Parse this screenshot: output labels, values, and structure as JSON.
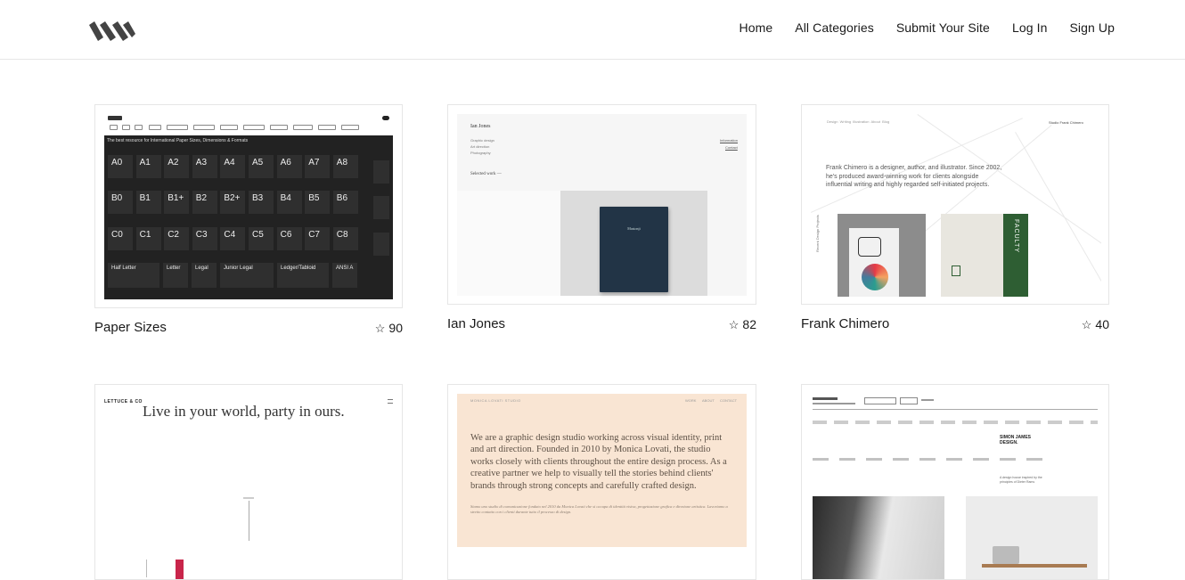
{
  "nav": {
    "home": "Home",
    "all_categories": "All Categories",
    "submit_site": "Submit Your Site",
    "log_in": "Log In",
    "sign_up": "Sign Up"
  },
  "cards": [
    {
      "title": "Paper Sizes",
      "stars": "90"
    },
    {
      "title": "Ian Jones",
      "stars": "82"
    },
    {
      "title": "Frank Chimero",
      "stars": "40"
    },
    {
      "title": "",
      "stars": ""
    },
    {
      "title": "",
      "stars": ""
    },
    {
      "title": "",
      "stars": ""
    }
  ],
  "paper_sizes": {
    "banner": "The best resource for International Paper Sizes, Dimensions & Formats",
    "row_a": [
      "A0",
      "A1",
      "A2",
      "A3",
      "A4",
      "A5",
      "A6",
      "A7",
      "A8"
    ],
    "row_b": [
      "B0",
      "B1",
      "B1+",
      "B2",
      "B2+",
      "B3",
      "B4",
      "B5",
      "B6"
    ],
    "row_c": [
      "C0",
      "C1",
      "C2",
      "C3",
      "C4",
      "C5",
      "C6",
      "C7",
      "C8"
    ],
    "row_us": [
      "Half Letter",
      "Letter",
      "Legal",
      "Junior Legal",
      "Ledger/Tabloid",
      "ANSI A"
    ]
  },
  "ian_jones": {
    "name": "Ian Jones",
    "roles": [
      "Graphic design",
      "Art direction",
      "Photography"
    ],
    "links": [
      "Information",
      "Contact"
    ],
    "selected": "Selected work —",
    "book": "Mustonji"
  },
  "frank": {
    "nav": "Design  Writing  Illustration  About  Blog",
    "studio": "Studio Frank Chimero",
    "bio": "Frank Chimero is a designer, author, and illustrator. Since 2002, he's produced award-winning work for clients alongside influential writing and highly regarded self-initiated projects.",
    "side": "Recent Design Projects",
    "faculty": "FACULTY"
  },
  "lettuce": {
    "brand": "LETTUCE & CO",
    "headline": "Live in your world, party in ours."
  },
  "studio": {
    "header_left": "MONICA LOVATI STUDIO",
    "links": [
      "WORK",
      "ABOUT",
      "CONTACT"
    ],
    "body": "We are a graphic design studio working across visual identity, print and art direction. Founded in 2010 by Monica Lovati, the studio works closely with clients throughout the entire design process. As a creative partner we help to visually tell the stories behind clients' brands through strong concepts and carefully crafted design.",
    "body_it": "Siamo uno studio di comunicazione fondato nel 2010 da Monica Lovati che si occupa di identità visiva, progettazione grafica e direzione artistica. Lavoriamo a stretto contatto con i clienti durante tutto il processo di design."
  },
  "simon": {
    "title": "SIMON JAMES DESIGN.",
    "sub": "A design house inspired by the principles of Dieter Rams"
  },
  "colors": {
    "accent_green": "#2e5e33",
    "book_blue": "#223446",
    "peach": "#f9e5d3",
    "crimson": "#c8254a"
  }
}
